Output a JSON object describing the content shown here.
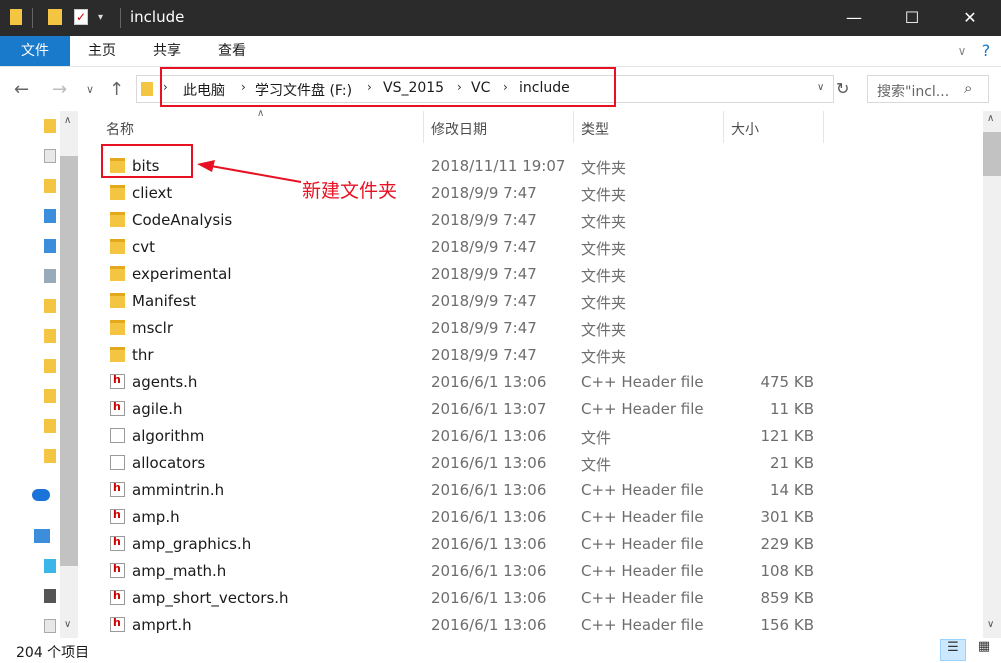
{
  "window": {
    "title": "include",
    "minimize": "—",
    "maximize": "☐",
    "close": "✕"
  },
  "ribbon": {
    "tabs": [
      "文件",
      "主页",
      "共享",
      "查看"
    ]
  },
  "address": {
    "crumbs": [
      "此电脑",
      "学习文件盘 (F:)",
      "VS_2015",
      "VC",
      "include"
    ]
  },
  "search": {
    "placeholder": "搜索\"incl..."
  },
  "columns": {
    "name": "名称",
    "date": "修改日期",
    "type": "类型",
    "size": "大小"
  },
  "annotation": {
    "text": "新建文件夹",
    "color": "#e81123"
  },
  "files": [
    {
      "name": "bits",
      "date": "2018/11/11 19:07",
      "type": "文件夹",
      "size": "",
      "icon": "folder"
    },
    {
      "name": "cliext",
      "date": "2018/9/9 7:47",
      "type": "文件夹",
      "size": "",
      "icon": "folder"
    },
    {
      "name": "CodeAnalysis",
      "date": "2018/9/9 7:47",
      "type": "文件夹",
      "size": "",
      "icon": "folder"
    },
    {
      "name": "cvt",
      "date": "2018/9/9 7:47",
      "type": "文件夹",
      "size": "",
      "icon": "folder"
    },
    {
      "name": "experimental",
      "date": "2018/9/9 7:47",
      "type": "文件夹",
      "size": "",
      "icon": "folder"
    },
    {
      "name": "Manifest",
      "date": "2018/9/9 7:47",
      "type": "文件夹",
      "size": "",
      "icon": "folder"
    },
    {
      "name": "msclr",
      "date": "2018/9/9 7:47",
      "type": "文件夹",
      "size": "",
      "icon": "folder"
    },
    {
      "name": "thr",
      "date": "2018/9/9 7:47",
      "type": "文件夹",
      "size": "",
      "icon": "folder"
    },
    {
      "name": "agents.h",
      "date": "2016/6/1 13:06",
      "type": "C++ Header file",
      "size": "475 KB",
      "icon": "hfile"
    },
    {
      "name": "agile.h",
      "date": "2016/6/1 13:07",
      "type": "C++ Header file",
      "size": "11 KB",
      "icon": "hfile"
    },
    {
      "name": "algorithm",
      "date": "2016/6/1 13:06",
      "type": "文件",
      "size": "121 KB",
      "icon": "file"
    },
    {
      "name": "allocators",
      "date": "2016/6/1 13:06",
      "type": "文件",
      "size": "21 KB",
      "icon": "file"
    },
    {
      "name": "ammintrin.h",
      "date": "2016/6/1 13:06",
      "type": "C++ Header file",
      "size": "14 KB",
      "icon": "hfile"
    },
    {
      "name": "amp.h",
      "date": "2016/6/1 13:06",
      "type": "C++ Header file",
      "size": "301 KB",
      "icon": "hfile"
    },
    {
      "name": "amp_graphics.h",
      "date": "2016/6/1 13:06",
      "type": "C++ Header file",
      "size": "229 KB",
      "icon": "hfile"
    },
    {
      "name": "amp_math.h",
      "date": "2016/6/1 13:06",
      "type": "C++ Header file",
      "size": "108 KB",
      "icon": "hfile"
    },
    {
      "name": "amp_short_vectors.h",
      "date": "2016/6/1 13:06",
      "type": "C++ Header file",
      "size": "859 KB",
      "icon": "hfile"
    },
    {
      "name": "amprt.h",
      "date": "2016/6/1 13:06",
      "type": "C++ Header file",
      "size": "156 KB",
      "icon": "hfile"
    }
  ],
  "status": {
    "count": "204 个项目"
  }
}
